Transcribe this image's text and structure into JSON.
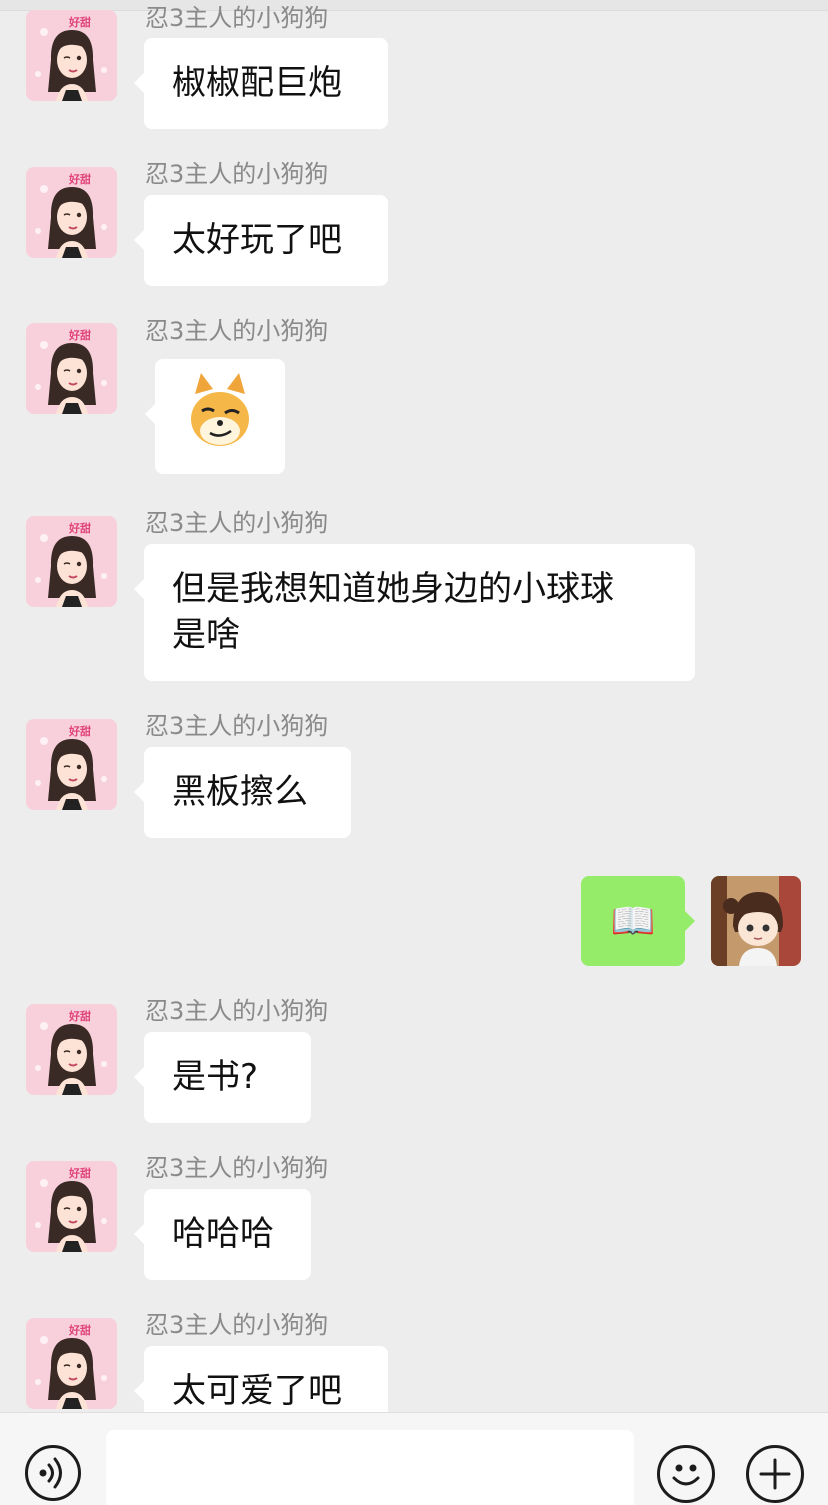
{
  "chat": {
    "messages": [
      {
        "sender": "忍3主人的小狗狗",
        "text": "椒椒配巨炮"
      },
      {
        "sender": "忍3主人的小狗狗",
        "text": "太好玩了吧"
      },
      {
        "sender": "忍3主人的小狗狗",
        "sticker": "doge-emoji"
      },
      {
        "sender": "忍3主人的小狗狗",
        "line1": "但是我想知道她身边的小球球",
        "line2": "是啥"
      },
      {
        "sender": "忍3主人的小狗狗",
        "text": "黑板擦么"
      },
      {
        "sender": "忍3主人的小狗狗",
        "text": "是书?"
      },
      {
        "sender": "忍3主人的小狗狗",
        "text": "哈哈哈"
      },
      {
        "sender": "忍3主人的小狗狗",
        "text": "太可爱了吧"
      }
    ],
    "outgoing": {
      "emoji": "📖"
    }
  },
  "inputbar": {
    "placeholder": "",
    "voice_icon": "voice-icon",
    "emoji_icon": "emoji-icon",
    "plus_icon": "plus-icon"
  },
  "colors": {
    "background": "#ededed",
    "incoming_bubble": "#ffffff",
    "outgoing_bubble": "#95ec69",
    "sender_text": "#8a8a8a"
  }
}
